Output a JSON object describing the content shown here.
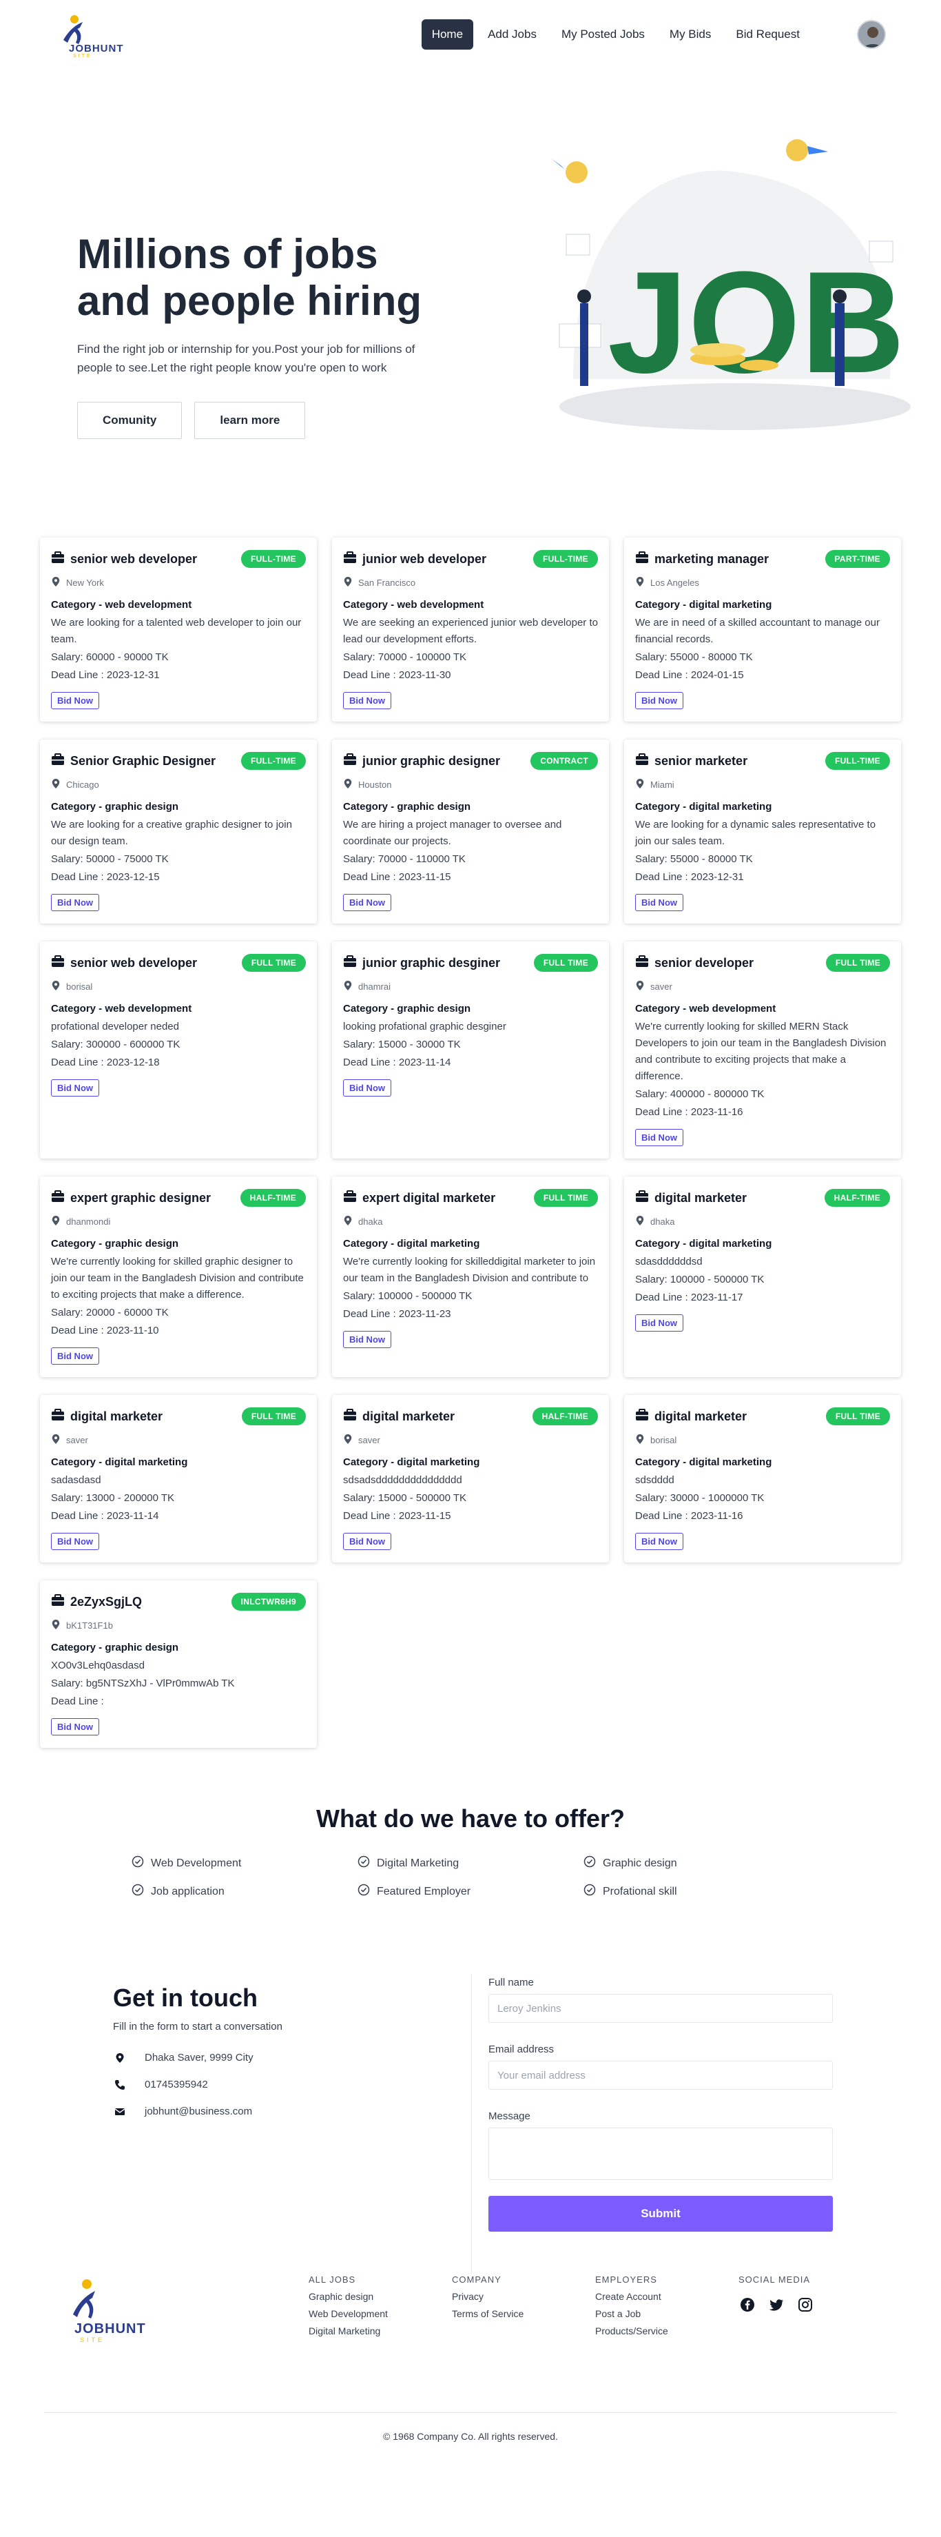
{
  "brand": {
    "name": "JOBHUNT",
    "tagline": "SITE"
  },
  "nav": {
    "items": [
      {
        "label": "Home",
        "active": true
      },
      {
        "label": "Add Jobs",
        "active": false
      },
      {
        "label": "My Posted Jobs",
        "active": false
      },
      {
        "label": "My Bids",
        "active": false
      },
      {
        "label": "Bid Request",
        "active": false
      }
    ],
    "avatar_icon": "user-avatar-icon"
  },
  "hero": {
    "title": "Millions of jobs and people hiring",
    "text": "Find the right job or internship for you.Post your job for millions of people to see.Let the right people know you're open to work",
    "buttons": [
      "Comunity",
      "learn more"
    ],
    "illustration_text": "JOB"
  },
  "jobs": [
    {
      "title": "senior web developer",
      "type": "FULL-TIME",
      "location": "New York",
      "category": "Category - web development",
      "description": "We are looking for a talented web developer to join our team.",
      "salary": "Salary: 60000 - 90000 TK",
      "deadline": "Dead Line : 2023-12-31",
      "bid": "Bid Now"
    },
    {
      "title": "junior web developer",
      "type": "FULL-TIME",
      "location": "San Francisco",
      "category": "Category - web development",
      "description": "We are seeking an experienced junior web developer to lead our development efforts.",
      "salary": "Salary: 70000 - 100000 TK",
      "deadline": "Dead Line : 2023-11-30",
      "bid": "Bid Now"
    },
    {
      "title": "marketing manager",
      "type": "PART-TIME",
      "location": "Los Angeles",
      "category": "Category - digital marketing",
      "description": "We are in need of a skilled accountant to manage our financial records.",
      "salary": "Salary: 55000 - 80000 TK",
      "deadline": "Dead Line : 2024-01-15",
      "bid": "Bid Now"
    },
    {
      "title": "Senior Graphic Designer",
      "type": "FULL-TIME",
      "location": "Chicago",
      "category": "Category - graphic design",
      "description": "We are looking for a creative graphic designer to join our design team.",
      "salary": "Salary: 50000 - 75000 TK",
      "deadline": "Dead Line : 2023-12-15",
      "bid": "Bid Now"
    },
    {
      "title": "junior graphic designer",
      "type": "CONTRACT",
      "location": "Houston",
      "category": "Category - graphic design",
      "description": "We are hiring a project manager to oversee and coordinate our projects.",
      "salary": "Salary: 70000 - 110000 TK",
      "deadline": "Dead Line : 2023-11-15",
      "bid": "Bid Now"
    },
    {
      "title": "senior marketer",
      "type": "FULL-TIME",
      "location": "Miami",
      "category": "Category - digital marketing",
      "description": "We are looking for a dynamic sales representative to join our sales team.",
      "salary": "Salary: 55000 - 80000 TK",
      "deadline": "Dead Line : 2023-12-31",
      "bid": "Bid Now"
    },
    {
      "title": "senior web developer",
      "type": "FULL TIME",
      "location": "borisal",
      "category": "Category - web development",
      "description": "profational developer neded",
      "salary": "Salary: 300000 - 600000 TK",
      "deadline": "Dead Line : 2023-12-18",
      "bid": "Bid Now"
    },
    {
      "title": "junior graphic desginer",
      "type": "FULL TIME",
      "location": "dhamrai",
      "category": "Category - graphic design",
      "description": "looking profational graphic desginer",
      "salary": "Salary: 15000 - 30000 TK",
      "deadline": "Dead Line : 2023-11-14",
      "bid": "Bid Now"
    },
    {
      "title": "senior developer",
      "type": "FULL TIME",
      "location": "saver",
      "category": "Category - web development",
      "description": "We're currently looking for skilled MERN Stack Developers to join our team in the Bangladesh Division and contribute to exciting projects that make a difference.",
      "salary": "Salary: 400000 - 800000 TK",
      "deadline": "Dead Line : 2023-11-16",
      "bid": "Bid Now"
    },
    {
      "title": "expert graphic designer",
      "type": "HALF-TIME",
      "location": "dhanmondi",
      "category": "Category - graphic design",
      "description": "We're currently looking for skilled graphic designer to join our team in the Bangladesh Division and contribute to exciting projects that make a difference.",
      "salary": "Salary: 20000 - 60000 TK",
      "deadline": "Dead Line : 2023-11-10",
      "bid": "Bid Now"
    },
    {
      "title": "expert digital marketer",
      "type": "FULL TIME",
      "location": "dhaka",
      "category": "Category - digital marketing",
      "description": "We're currently looking for skilleddigital marketer to join our team in the Bangladesh Division and contribute to",
      "salary": "Salary: 100000 - 500000 TK",
      "deadline": "Dead Line : 2023-11-23",
      "bid": "Bid Now"
    },
    {
      "title": "digital marketer",
      "type": "HALF-TIME",
      "location": "dhaka",
      "category": "Category - digital marketing",
      "description": "sdasddddddsd",
      "salary": "Salary: 100000 - 500000 TK",
      "deadline": "Dead Line : 2023-11-17",
      "bid": "Bid Now"
    },
    {
      "title": "digital marketer",
      "type": "FULL TIME",
      "location": "saver",
      "category": "Category - digital marketing",
      "description": "sadasdasd",
      "salary": "Salary: 13000 - 200000 TK",
      "deadline": "Dead Line : 2023-11-14",
      "bid": "Bid Now"
    },
    {
      "title": "digital marketer",
      "type": "HALF-TIME",
      "location": "saver",
      "category": "Category - digital marketing",
      "description": "sdsadsddddddddddddddd",
      "salary": "Salary: 15000 - 500000 TK",
      "deadline": "Dead Line : 2023-11-15",
      "bid": "Bid Now"
    },
    {
      "title": "digital marketer",
      "type": "FULL TIME",
      "location": "borisal",
      "category": "Category - digital marketing",
      "description": "sdsdddd",
      "salary": "Salary: 30000 - 1000000 TK",
      "deadline": "Dead Line : 2023-11-16",
      "bid": "Bid Now"
    },
    {
      "title": "2eZyxSgjLQ",
      "type": "INlCTWR6H9",
      "location": "bK1T31F1b",
      "category": "Category - graphic design",
      "description": "XO0v3Lehq0asdasd",
      "salary": "Salary: bg5NTSzXhJ - VlPr0mmwAb TK",
      "deadline": "Dead Line :",
      "bid": "Bid Now"
    }
  ],
  "offer": {
    "title": "What do we have to offer?",
    "items": [
      "Web Development",
      "Digital Marketing",
      "Graphic design",
      "Job application",
      "Featured Employer",
      "Profational skill"
    ]
  },
  "contact": {
    "title": "Get in touch",
    "subtitle": "Fill in the form to start a conversation",
    "address": "Dhaka Saver, 9999 City",
    "phone": "01745395942",
    "email": "jobhunt@business.com",
    "form": {
      "name_label": "Full name",
      "name_placeholder": "Leroy Jenkins",
      "email_label": "Email address",
      "email_placeholder": "Your email address",
      "message_label": "Message",
      "submit": "Submit"
    }
  },
  "footer": {
    "columns": [
      {
        "title": "ALL JOBS",
        "links": [
          "Graphic design",
          "Web Development",
          "Digital Marketing"
        ]
      },
      {
        "title": "COMPANY",
        "links": [
          "Privacy",
          "Terms of Service"
        ]
      },
      {
        "title": "EMPLOYERS",
        "links": [
          "Create Account",
          "Post a Job",
          "Products/Service"
        ]
      }
    ],
    "social_title": "SOCIAL MEDIA",
    "social_icons": [
      "facebook-icon",
      "twitter-icon",
      "instagram-icon"
    ],
    "copyright": "© 1968 Company Co. All rights reserved."
  },
  "colors": {
    "accent": "#7c5cff",
    "badge": "#22c55e",
    "nav_active": "#283244",
    "link": "#4f46e5",
    "job_green": "#1e7a43"
  }
}
